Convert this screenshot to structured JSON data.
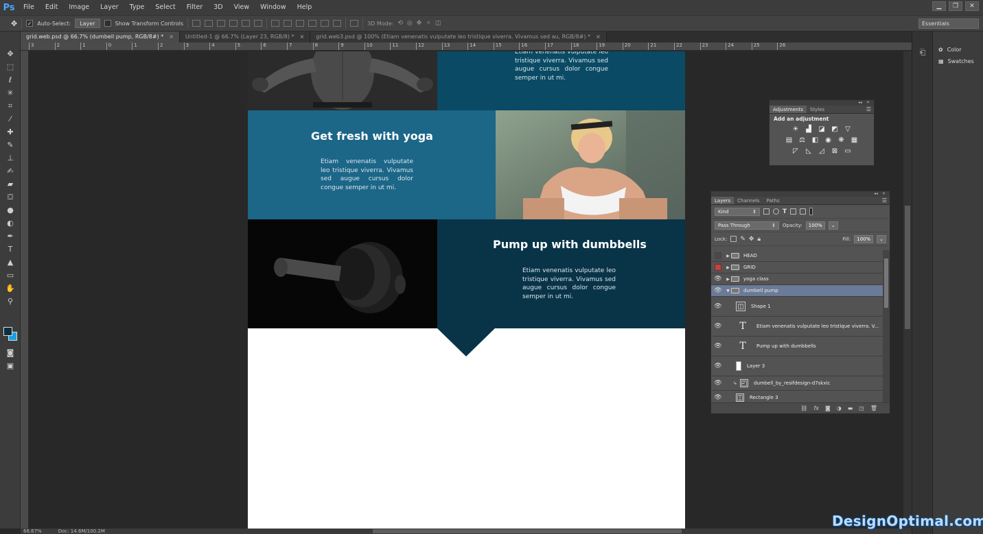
{
  "app": {
    "logo": "Ps"
  },
  "menu": [
    "File",
    "Edit",
    "Image",
    "Layer",
    "Type",
    "Select",
    "Filter",
    "3D",
    "View",
    "Window",
    "Help"
  ],
  "window_controls": [
    "▁",
    "❐",
    "✕"
  ],
  "options_bar": {
    "auto_select_label": "Auto-Select:",
    "auto_select_value": "Layer",
    "transform_label": "Show Transform Controls",
    "mode_label": "3D Mode:",
    "workspace": "Essentials"
  },
  "tabs": [
    {
      "label": "grid.web.psd @ 66.7% (dumbell pump, RGB/8#) *",
      "active": true
    },
    {
      "label": "Untitled-1 @ 66.7% (Layer 23, RGB/8) *",
      "active": false
    },
    {
      "label": "grid.web3.psd @ 100% (Etiam venenatis vulputate leo tristique viverra. Vivamus sed au, RGB/8#) *",
      "active": false
    }
  ],
  "ruler_ticks": [
    "3",
    "2",
    "1",
    "0",
    "1",
    "2",
    "3",
    "4",
    "5",
    "6",
    "7",
    "8",
    "9",
    "10",
    "11",
    "12",
    "13",
    "14",
    "15",
    "16",
    "17",
    "18",
    "19",
    "20",
    "21",
    "22",
    "23",
    "24",
    "25",
    "26"
  ],
  "canvas": {
    "top_text": "Etiam venenatis vulputate leo tristique viverra. Vivamus sed augue cursus dolor congue semper in ut mi.",
    "yoga_title": "Get fresh with yoga",
    "yoga_text": "Etiam venenatis vulputate leo tristique viverra. Vivamus sed augue cursus dolor congue semper in ut mi.",
    "dumbbell_title": "Pump up with dumbbells",
    "dumbbell_text": "Etiam venenatis vulputate leo tristique viverra. Vivamus sed augue cursus dolor congue semper in ut mi."
  },
  "colors": {
    "teal_dark": "#0a4a64",
    "teal_mid": "#1c6688",
    "teal_darkest": "#093448",
    "fg": "#0b2f40",
    "bg": "#1a9fe0"
  },
  "status": {
    "zoom": "66.67%",
    "doc": "Doc: 14.6M/100.2M"
  },
  "dock": {
    "items": [
      {
        "label": "Color",
        "icon": "palette-icon"
      },
      {
        "label": "Swatches",
        "icon": "swatches-icon"
      }
    ]
  },
  "adjustments": {
    "tabs": [
      "Adjustments",
      "Styles"
    ],
    "heading": "Add an adjustment"
  },
  "layers_panel": {
    "tabs": [
      "Layers",
      "Channels",
      "Paths"
    ],
    "filter": "Kind",
    "blend_mode": "Pass Through",
    "opacity_label": "Opacity:",
    "opacity": "100%",
    "lock_label": "Lock:",
    "fill_label": "Fill:",
    "fill": "100%",
    "layers": [
      {
        "name": "HEAD",
        "kind": "group",
        "visibility": "hidden"
      },
      {
        "name": "GRID",
        "kind": "group",
        "visibility": "red"
      },
      {
        "name": "yoga class",
        "kind": "group",
        "visibility": "visible"
      },
      {
        "name": "dumbell pump",
        "kind": "group-open",
        "visibility": "visible"
      },
      {
        "name": "Shape 1",
        "kind": "shape",
        "visibility": "visible"
      },
      {
        "name": "Etiam venenatis vulputate leo tristique viverra. V...",
        "kind": "text",
        "visibility": "visible"
      },
      {
        "name": "Pump up with dumbbells",
        "kind": "text",
        "visibility": "visible"
      },
      {
        "name": "Layer 3",
        "kind": "pixel",
        "visibility": "visible"
      },
      {
        "name": "dumbell_by_resifdesign-d7skxic",
        "kind": "smart",
        "visibility": "visible"
      },
      {
        "name": "Rectangle 3",
        "kind": "shape",
        "visibility": "visible"
      }
    ]
  },
  "watermark": "DesignOptimal.com"
}
